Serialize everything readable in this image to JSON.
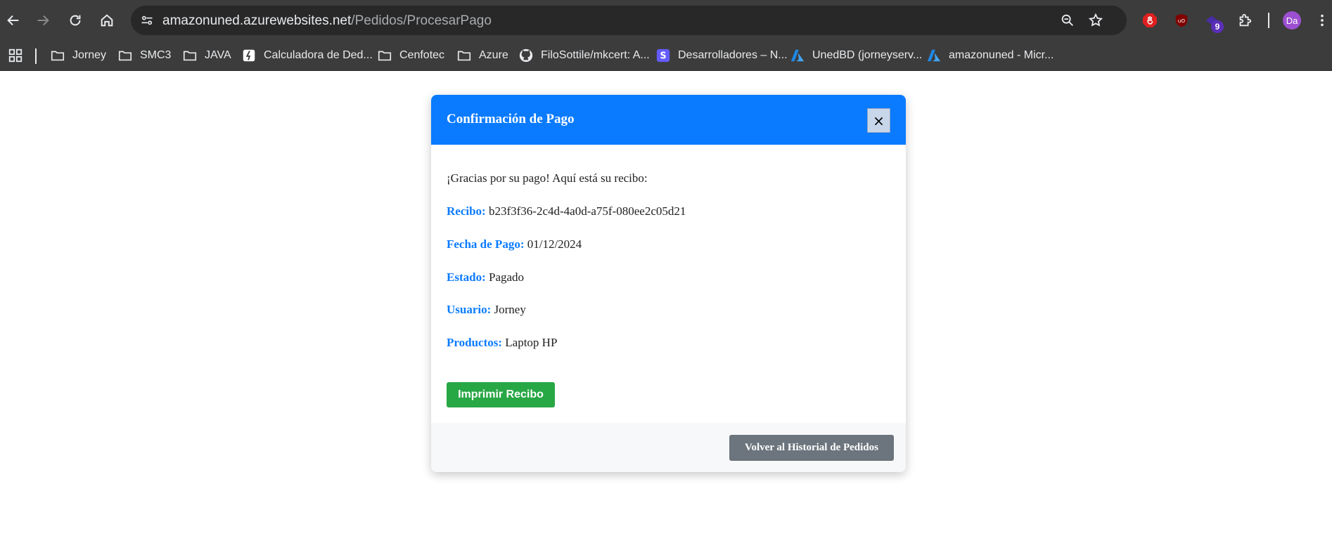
{
  "browser": {
    "url_host": "amazonuned.azurewebsites.net",
    "url_path": "/Pedidos/ProcesarPago",
    "extension_badge": "9",
    "profile_initials": "Da"
  },
  "bookmarks": [
    {
      "label": "Jorney",
      "icon": "folder-icon"
    },
    {
      "label": "SMC3",
      "icon": "folder-icon"
    },
    {
      "label": "JAVA",
      "icon": "folder-icon"
    },
    {
      "label": "Calculadora de Ded...",
      "icon": "calculator-icon"
    },
    {
      "label": "Cenfotec",
      "icon": "folder-icon"
    },
    {
      "label": "Azure",
      "icon": "folder-icon"
    },
    {
      "label": "FiloSottile/mkcert: A...",
      "icon": "github-icon"
    },
    {
      "label": "Desarrolladores – N...",
      "icon": "s-logo-icon"
    },
    {
      "label": "UnedBD (jorneyserv...",
      "icon": "azure-icon"
    },
    {
      "label": "amazonuned - Micr...",
      "icon": "azure-icon"
    }
  ],
  "modal": {
    "title": "Confirmación de Pago",
    "close_label": "×",
    "intro": "¡Gracias por su pago! Aquí está su recibo:",
    "fields": [
      {
        "label": "Recibo:",
        "value": "b23f3f36-2c4d-4a0d-a75f-080ee2c05d21"
      },
      {
        "label": "Fecha de Pago:",
        "value": "01/12/2024"
      },
      {
        "label": "Estado:",
        "value": "Pagado"
      },
      {
        "label": "Usuario:",
        "value": "Jorney"
      },
      {
        "label": "Productos:",
        "value": "Laptop HP"
      }
    ],
    "print_button": "Imprimir Recibo",
    "back_button": "Volver al Historial de Pedidos"
  },
  "colors": {
    "header_blue": "#0a7bff",
    "print_green": "#28a745",
    "back_gray": "#6c757d"
  }
}
